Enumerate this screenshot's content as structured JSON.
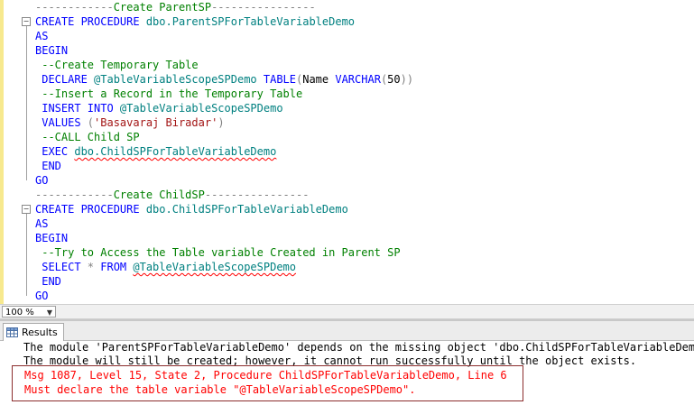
{
  "editor": {
    "lines": [
      [
        {
          "c": "gr",
          "t": "------------"
        },
        {
          "c": "cm",
          "t": "Create ParentSP"
        },
        {
          "c": "gr",
          "t": "----------------"
        }
      ],
      [
        {
          "c": "kw",
          "t": "CREATE PROCEDURE "
        },
        {
          "c": "obj",
          "t": "dbo.ParentSPForTableVariableDemo"
        }
      ],
      [
        {
          "c": "kw",
          "t": "AS"
        }
      ],
      [
        {
          "c": "kw",
          "t": "BEGIN"
        }
      ],
      [
        {
          "c": "cm",
          "t": " --Create Temporary Table"
        }
      ],
      [
        {
          "c": "kw",
          "t": " DECLARE "
        },
        {
          "c": "obj",
          "t": "@TableVariableScopeSPDemo "
        },
        {
          "c": "kw",
          "t": "TABLE"
        },
        {
          "c": "gr",
          "t": "("
        },
        {
          "c": "",
          "t": "Name "
        },
        {
          "c": "kw",
          "t": "VARCHAR"
        },
        {
          "c": "gr",
          "t": "("
        },
        {
          "c": "",
          "t": "50"
        },
        {
          "c": "gr",
          "t": "))"
        }
      ],
      [
        {
          "c": "cm",
          "t": " --Insert a Record in the Temporary Table"
        }
      ],
      [
        {
          "c": "kw",
          "t": " INSERT INTO "
        },
        {
          "c": "obj",
          "t": "@TableVariableScopeSPDemo"
        }
      ],
      [
        {
          "c": "kw",
          "t": " VALUES "
        },
        {
          "c": "gr",
          "t": "("
        },
        {
          "c": "str",
          "t": "'Basavaraj Biradar'"
        },
        {
          "c": "gr",
          "t": ")"
        }
      ],
      [
        {
          "c": "cm",
          "t": " --CALL Child SP"
        }
      ],
      [
        {
          "c": "kw",
          "t": " EXEC "
        },
        {
          "c": "obj squig",
          "t": "dbo.ChildSPForTableVariableDemo"
        }
      ],
      [
        {
          "c": "kw",
          "t": " END"
        }
      ],
      [
        {
          "c": "kw",
          "t": "GO"
        }
      ],
      [
        {
          "c": "gr",
          "t": "------------"
        },
        {
          "c": "cm",
          "t": "Create ChildSP"
        },
        {
          "c": "gr",
          "t": "----------------"
        }
      ],
      [
        {
          "c": "kw",
          "t": "CREATE PROCEDURE "
        },
        {
          "c": "obj",
          "t": "dbo.ChildSPForTableVariableDemo"
        }
      ],
      [
        {
          "c": "kw",
          "t": "AS"
        }
      ],
      [
        {
          "c": "kw",
          "t": "BEGIN"
        }
      ],
      [
        {
          "c": "cm",
          "t": " --Try to Access the Table variable Created in Parent SP"
        }
      ],
      [
        {
          "c": "kw",
          "t": " SELECT "
        },
        {
          "c": "gr",
          "t": "* "
        },
        {
          "c": "kw",
          "t": "FROM "
        },
        {
          "c": "obj squig",
          "t": "@TableVariableScopeSPDemo"
        }
      ],
      [
        {
          "c": "kw",
          "t": " END"
        }
      ],
      [
        {
          "c": "kw",
          "t": "GO"
        }
      ]
    ]
  },
  "status": {
    "zoom": "100 %"
  },
  "results_tab": {
    "label": "Results"
  },
  "messages": {
    "line1": "The module 'ParentSPForTableVariableDemo' depends on the missing object 'dbo.ChildSPForTableVariableDemo'.",
    "line2": "The module will still be created; however, it cannot run successfully until the object exists.",
    "error1": "Msg 1087, Level 15, State 2, Procedure ChildSPForTableVariableDemo, Line 6",
    "error2": "Must declare the table variable \"@TableVariableScopeSPDemo\"."
  },
  "colors": {
    "keyword": "#0000ff",
    "comment": "#008000",
    "string": "#a31515",
    "error": "#ff0000"
  }
}
